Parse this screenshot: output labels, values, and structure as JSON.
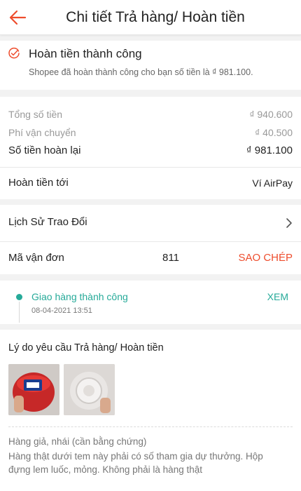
{
  "header": {
    "title": "Chi tiết Trả hàng/ Hoàn tiền",
    "back_icon": "arrow-left-icon"
  },
  "colors": {
    "accent": "#ee4d2d",
    "success": "#26aa99"
  },
  "status": {
    "title": "Hoàn tiền thành công",
    "description": "Shopee đã hoàn thành công cho bạn số tiền là ₫ 981.100."
  },
  "amounts": {
    "total_label": "Tổng số tiền",
    "total_value": "₫ 940.600",
    "shipping_label": "Phí vận chuyển",
    "shipping_value": "₫ 40.500",
    "refund_label": "Số tiền hoàn lại",
    "refund_value": "₫ 981.100"
  },
  "refund_to": {
    "label": "Hoàn tiền tới",
    "value": "Ví AirPay"
  },
  "history": {
    "label": "Lịch Sử Trao Đổi"
  },
  "tracking": {
    "label": "Mã vận đơn",
    "value": "811",
    "copy_label": "SAO CHÉP"
  },
  "delivery": {
    "title": "Giao hàng thành công",
    "time": "08-04-2021 13:51",
    "view_label": "XEM"
  },
  "reason": {
    "title": "Lý do yêu cầu Trả hàng/ Hoàn tiền",
    "type": "Hàng giả, nhái (cần bằng chứng)",
    "description": "Hàng thật dưới tem này phải có số tham gia dự thưởng. Hộp đựng lem luốc, mỏng. Không phải là hàng thật"
  }
}
